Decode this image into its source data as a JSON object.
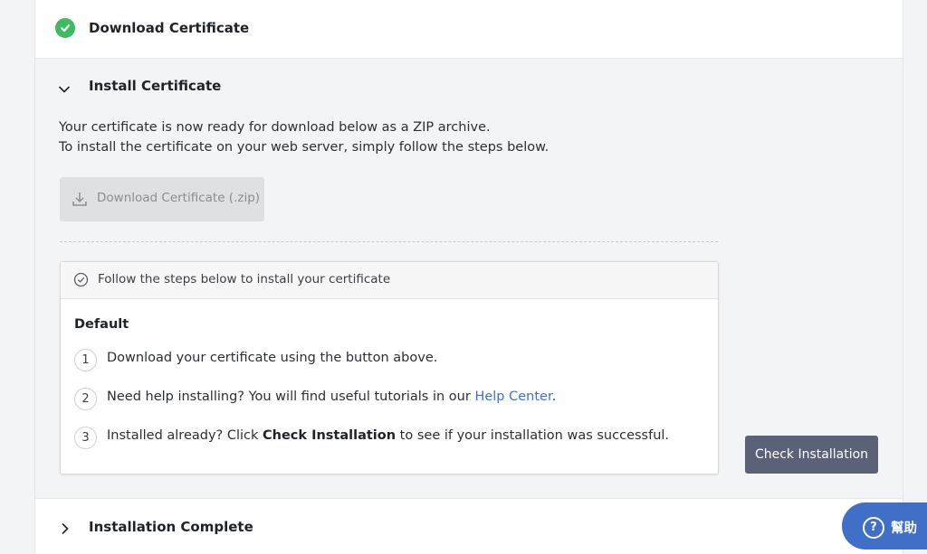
{
  "steps": {
    "download": {
      "title": "Download Certificate",
      "status_icon": "check-circle-icon",
      "status_color": "#3dbb61"
    },
    "install": {
      "title": "Install Certificate",
      "description_line1": "Your certificate is now ready for download below as a ZIP archive.",
      "description_line2": "To install the certificate on your web server, simply follow the steps below.",
      "download_button": "Download Certificate (.zip)",
      "instructions": {
        "header": "Follow the steps below to install your certificate",
        "section_title": "Default",
        "items": [
          {
            "number": "1",
            "text": "Download your certificate using the button above."
          },
          {
            "number": "2",
            "text_before": "Need help installing? You will find useful tutorials in our ",
            "link": "Help Center",
            "text_after": "."
          },
          {
            "number": "3",
            "text_before": "Installed already? Click ",
            "bold": "Check Installation",
            "text_after": " to see if your installation was successful."
          }
        ]
      },
      "check_button": "Check Installation"
    },
    "complete": {
      "title": "Installation Complete"
    }
  },
  "help_widget": {
    "label": "幫助",
    "icon": "question-circle-icon",
    "color": "#3f6fc7"
  }
}
